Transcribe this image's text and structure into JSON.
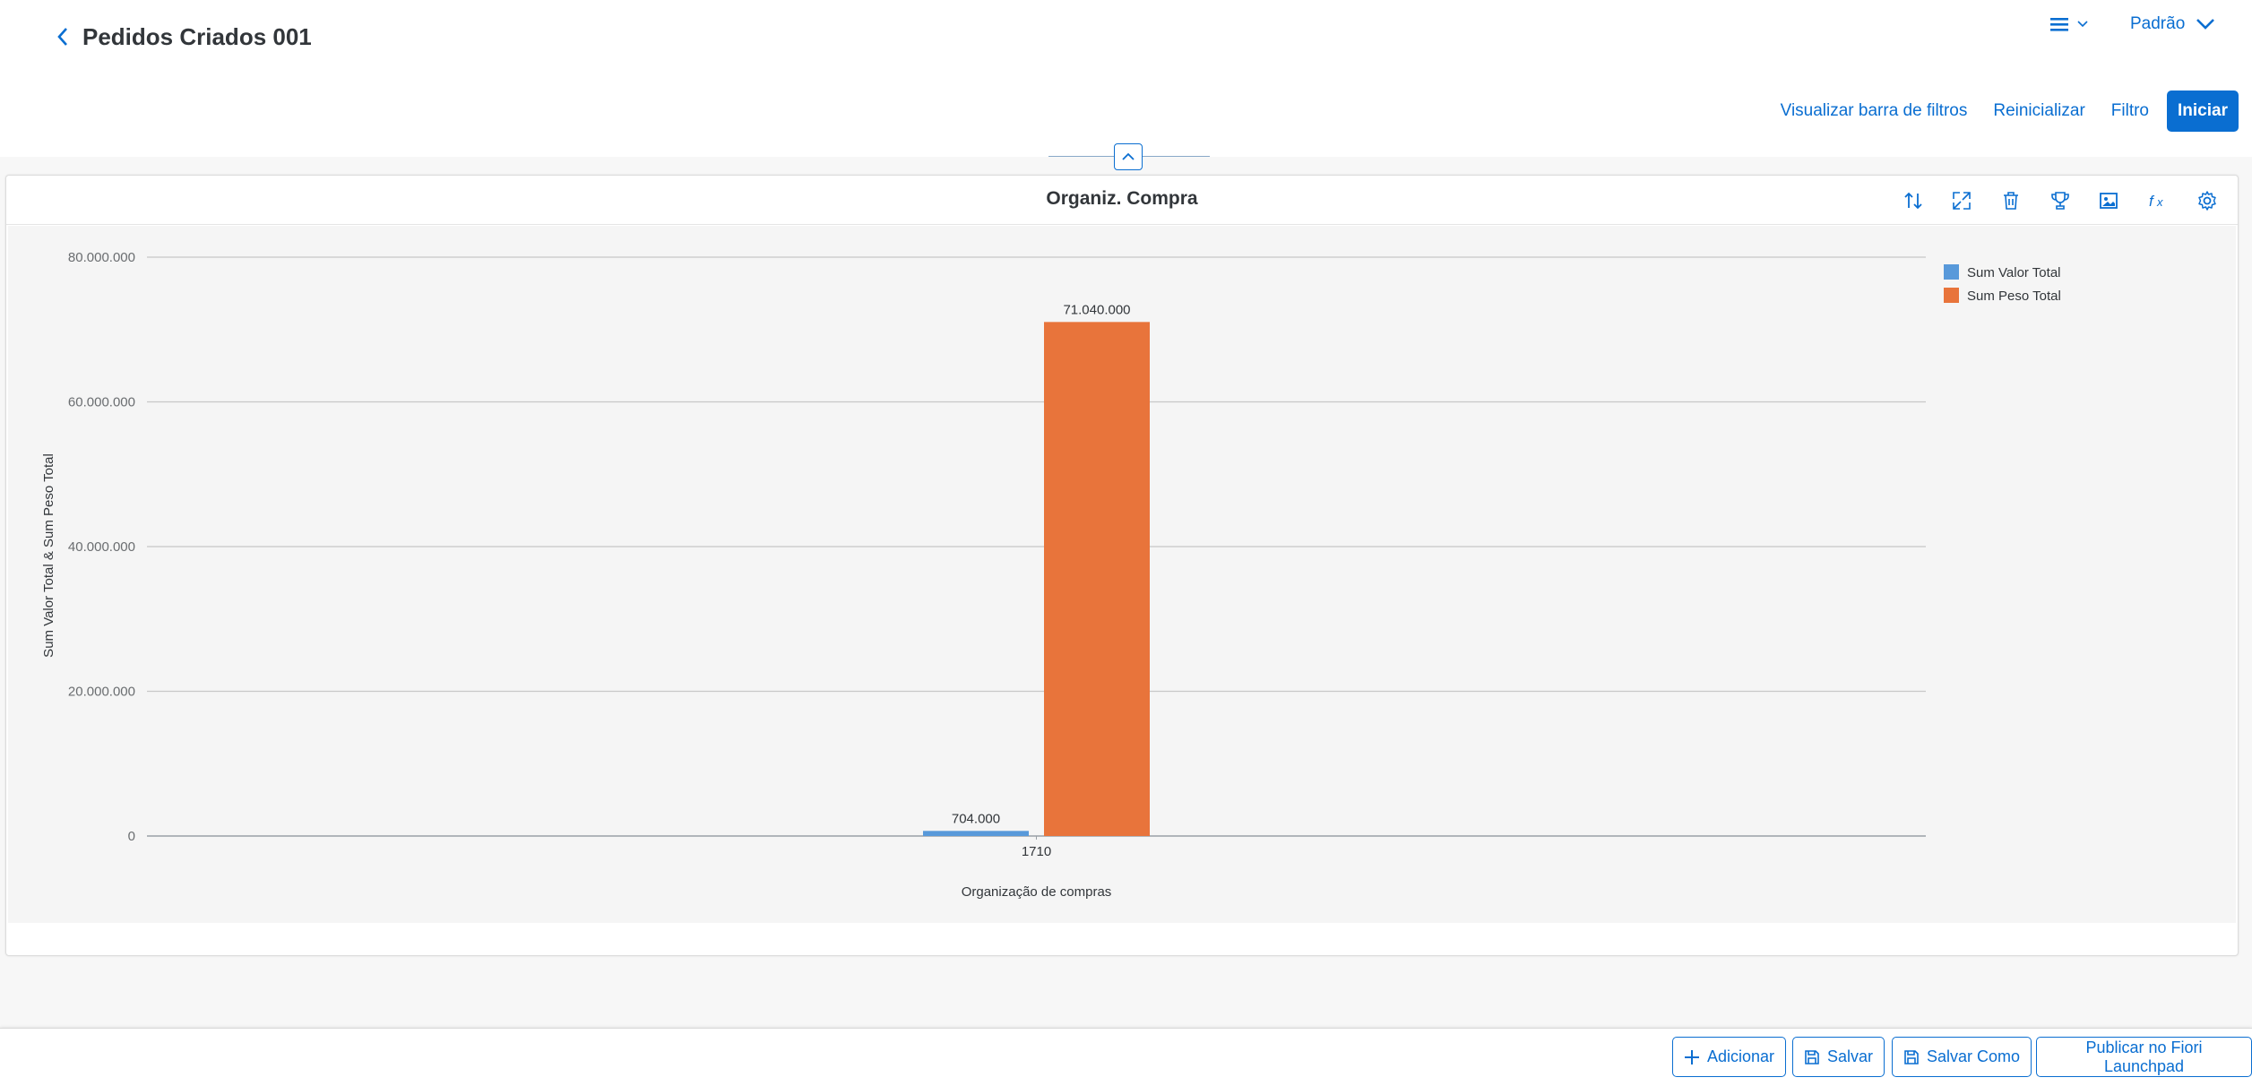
{
  "header": {
    "title": "Pedidos Criados 001",
    "variant": "Padrão",
    "links": {
      "show_filter_bar": "Visualizar barra de filtros",
      "reset": "Reinicializar",
      "filter": "Filtro",
      "go": "Iniciar"
    }
  },
  "chart_card": {
    "title": "Organiz. Compra",
    "toolbar_icons": [
      "sort-icon",
      "expand-icon",
      "delete-icon",
      "trophy-icon",
      "image-icon",
      "formula-icon",
      "settings-icon"
    ]
  },
  "chart_data": {
    "type": "bar",
    "title": "Organiz. Compra",
    "categories": [
      "1710"
    ],
    "series": [
      {
        "name": "Sum Valor Total",
        "values": [
          704000
        ],
        "labels": [
          "704.000"
        ],
        "color": "#5899da"
      },
      {
        "name": "Sum Peso Total",
        "values": [
          71040000
        ],
        "labels": [
          "71.040.000"
        ],
        "color": "#e8743b"
      }
    ],
    "xlabel": "Organização de compras",
    "ylabel": "Sum Valor Total & Sum Peso Total",
    "ylim": [
      0,
      80000000
    ],
    "yticks": [
      0,
      20000000,
      40000000,
      60000000,
      80000000
    ],
    "ytick_labels": [
      "0",
      "20.000.000",
      "40.000.000",
      "60.000.000",
      "80.000.000"
    ],
    "grid": true,
    "legend": "top-right"
  },
  "footer": {
    "add": "Adicionar",
    "save": "Salvar",
    "save_as": "Salvar Como",
    "publish": "Publicar no Fiori Launchpad"
  },
  "colors": {
    "accent": "#0a6ed1",
    "series1": "#5899da",
    "series2": "#e8743b"
  }
}
